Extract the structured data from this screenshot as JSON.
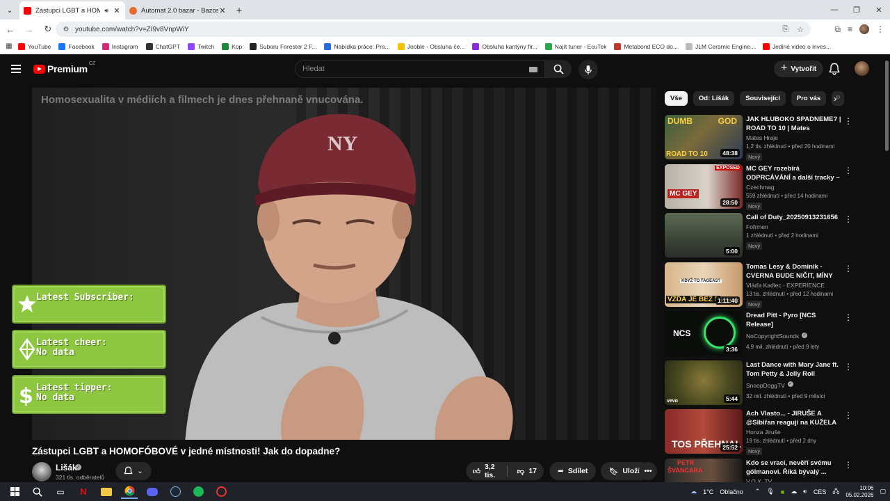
{
  "browser": {
    "tabs": [
      {
        "title": "Zástupci LGBT a HOMOFÓBOVÉ",
        "active": true,
        "favicon_color": "#ff0000"
      },
      {
        "title": "Automat 2.0 bazar - Bazos.cz",
        "active": false,
        "favicon_color": "#e66a2c"
      }
    ],
    "url": "youtube.com/watch?v=ZI9v8VnpWiY",
    "bookmarks": [
      {
        "label": "YouTube",
        "color": "#ff0000"
      },
      {
        "label": "Facebook",
        "color": "#1877f2"
      },
      {
        "label": "Instagram",
        "color": "#d62976"
      },
      {
        "label": "ChatGPT",
        "color": "#333333"
      },
      {
        "label": "Twitch",
        "color": "#9146ff"
      },
      {
        "label": "Kop",
        "color": "#1a8a3a"
      },
      {
        "label": "Subaru Forester 2 F...",
        "color": "#222222"
      },
      {
        "label": "Nabídka práce: Pro...",
        "color": "#2a6bd6"
      },
      {
        "label": "Jooble - Obsluha če...",
        "color": "#f2c200"
      },
      {
        "label": "Obsluha kantýny fir...",
        "color": "#8a2be2"
      },
      {
        "label": "Najít tuner - EcuTek",
        "color": "#2aa84a"
      },
      {
        "label": "Metabond ECO do...",
        "color": "#c0392b"
      },
      {
        "label": "JLM Ceramic Engine...",
        "color": "#bbbbbb"
      },
      {
        "label": "Jediné video o inves...",
        "color": "#ff0000"
      }
    ]
  },
  "yt": {
    "logo": "Premium",
    "country": "CZ",
    "search_placeholder": "Hledat",
    "create_label": "Vytvořit",
    "video": {
      "caption": "Homosexualita v médiích a filmech je dnes přehnaně vnucována.",
      "title": "Zástupci LGBT a HOMOFÓBOVÉ v jedné místnosti! Jak do dopadne?",
      "channel": "Lišák",
      "subscribers": "321 tis. odběratelů",
      "likes": "3,2 tis.",
      "dislikes": "17",
      "share": "Sdílet",
      "save": "Uložit"
    },
    "overlay": {
      "subscriber": [
        "Latest Subscriber:",
        ""
      ],
      "cheer": [
        "Latest cheer:",
        "No data"
      ],
      "tipper": [
        "Latest tipper:",
        "No data"
      ]
    },
    "chips": [
      "Vše",
      "Od: Lišák",
      "Související",
      "Pro vás",
      "P"
    ],
    "recommendations": [
      {
        "title": "JAK HLUBOKO SPADNEME? | ROAD TO 10 | Mates",
        "channel": "Mates Hraje",
        "meta": "1,2 tis. zhlédnutí • před 20 hodinami",
        "badge": "Nový",
        "duration": "48:38",
        "verified": false
      },
      {
        "title": "MC GEY rozebírá ODPRCÁVÁNÍ a další tracky – význam, příbě...",
        "channel": "Czechmag",
        "meta": "559 zhlédnutí • před 14 hodinami",
        "badge": "Nový",
        "duration": "28:50",
        "verified": false
      },
      {
        "title": "Call of Duty_20250913231656",
        "channel": "Fofrmen",
        "meta": "1 zhlédnutí • před 2 hodinami",
        "badge": "Nový",
        "duration": "5:00",
        "verified": false
      },
      {
        "title": "Tomas Lesy & Dominik - CVERNA BUDE NIČIT, MÍNY SE...",
        "channel": "Vláďa Kadlec - EXPERIENCE",
        "meta": "13 tis. zhlédnutí • před 12 hodinami",
        "badge": "Nový",
        "duration": "1:11:40",
        "verified": false
      },
      {
        "title": "Dread Pitt - Pyro [NCS Release]",
        "channel": "NoCopyrightSounds",
        "meta": "4,9 mil. zhlédnutí • před 9 lety",
        "badge": "",
        "duration": "3:36",
        "verified": true
      },
      {
        "title": "Last Dance with Mary Jane ft. Tom Petty & Jelly Roll (Official...",
        "channel": "SnoopDoggTV",
        "meta": "32 mil. zhlédnutí • před 9 měsíci",
        "badge": "",
        "duration": "5:44",
        "verified": true
      },
      {
        "title": "Ach Vlasto... - JIRUŠE A @Sibiřan  reagují na KUŽELA",
        "channel": "Honza Jiruše",
        "meta": "19 tis. zhlédnutí • před 2 dny",
        "badge": "Nový",
        "duration": "25:52",
        "verified": false
      },
      {
        "title": "Kdo se vrací, nevěří svému gólmanovi. Říká bývalý ...",
        "channel": "V.O.X. TV",
        "meta": "",
        "badge": "",
        "duration": "",
        "verified": false
      }
    ],
    "thumb_text": {
      "r1a": "DUMB",
      "r1b": "GOD",
      "r1c": "ROAD TO 10",
      "r2a": "EXPOSED",
      "r2b": "MC GEY",
      "r4a": "KDYŽ TO TAGEAS?",
      "r4b": "VZDÁ JE BEZ P",
      "r5a": "NCS",
      "r6a": "vevo",
      "r7a": "TOS PŘEHNAL",
      "r8a": "PETR",
      "r8b": "ŠVANCARA"
    }
  },
  "taskbar": {
    "weather_temp": "1°C",
    "weather_text": "Oblačno",
    "lang": "CES",
    "time": "10:06",
    "date": "05.02.2026"
  }
}
